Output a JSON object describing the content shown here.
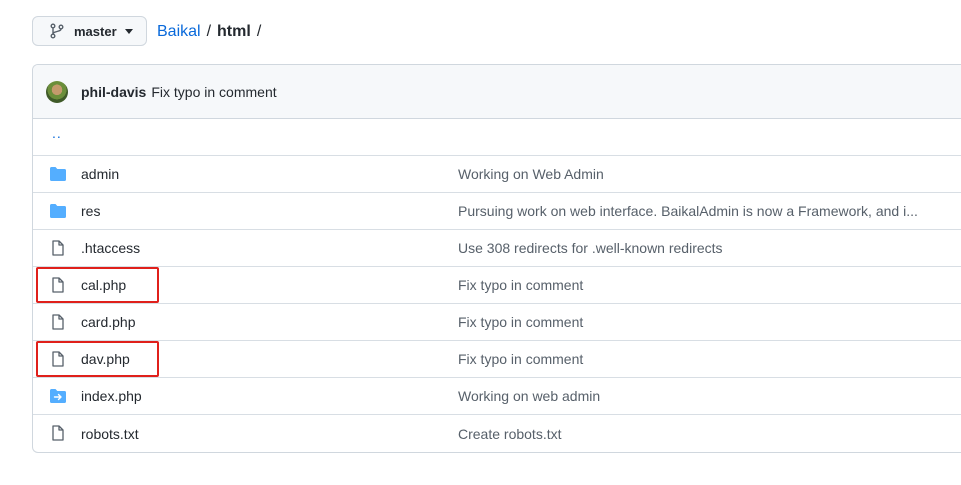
{
  "branch": {
    "name": "master",
    "icon": "git-branch-icon"
  },
  "breadcrumb": {
    "repo": "Baikal",
    "separator": "/",
    "current": "html",
    "trail": "/"
  },
  "commit": {
    "author": "phil-davis",
    "message": "Fix typo in comment",
    "avatar": "avatar"
  },
  "parent_dir": "..",
  "files": [
    {
      "name": "admin",
      "type": "directory",
      "icon": "folder-icon",
      "message": "Working on Web Admin"
    },
    {
      "name": "res",
      "type": "directory",
      "icon": "folder-icon",
      "message": "Pursuing work on web interface. BaikalAdmin is now a Framework, and i..."
    },
    {
      "name": ".htaccess",
      "type": "file",
      "icon": "file-icon",
      "message": "Use 308 redirects for .well-known redirects"
    },
    {
      "name": "cal.php",
      "type": "file",
      "icon": "file-icon",
      "message": "Fix typo in comment"
    },
    {
      "name": "card.php",
      "type": "file",
      "icon": "file-icon",
      "message": "Fix typo in comment"
    },
    {
      "name": "dav.php",
      "type": "file",
      "icon": "file-icon",
      "message": "Fix typo in comment"
    },
    {
      "name": "index.php",
      "type": "symlink",
      "icon": "symlink-directory-icon",
      "message": "Working on web admin"
    },
    {
      "name": "robots.txt",
      "type": "file",
      "icon": "file-icon",
      "message": "Create robots.txt"
    }
  ],
  "colors": {
    "link": "#0969da",
    "folder": "#54aeff",
    "highlight": "#e0201b"
  }
}
